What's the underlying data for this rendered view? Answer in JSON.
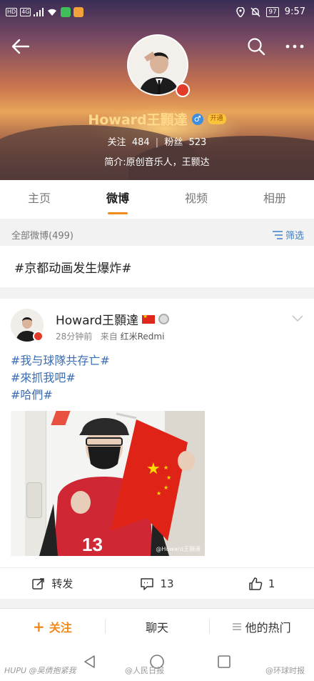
{
  "status_bar": {
    "left_chip1": "HD",
    "left_chip2": "4G",
    "battery": "97",
    "time": "9:57"
  },
  "profile": {
    "name": "Howard王顥達",
    "gender_symbol": "♂",
    "vip_label": "开通",
    "follow_label": "关注",
    "follow_count": "484",
    "fans_label": "粉丝",
    "fans_count": "523",
    "bio": "简介:原创音乐人，王颢达"
  },
  "tabs": [
    {
      "label": "主页"
    },
    {
      "label": "微博"
    },
    {
      "label": "视频"
    },
    {
      "label": "相册"
    }
  ],
  "filter_bar": {
    "all_posts": "全部微博(499)",
    "filter": "筛选"
  },
  "topic_card": {
    "text": "#京都动画发生爆炸#"
  },
  "post": {
    "author": "Howard王顥達",
    "time": "28分钟前",
    "from_label": "来自",
    "source": "红米Redmi",
    "tags": [
      "#我与球隊共存亡#",
      "#來抓我吧#",
      "#哈們#"
    ],
    "image_watermark": "@Howard王顥達",
    "repost_label": "转发",
    "comment_count": "13",
    "like_count": "1"
  },
  "bottom_bar": {
    "follow_plus": "+",
    "follow": "关注",
    "chat": "聊天",
    "hot": "他的热门"
  },
  "watermarks": {
    "left": "HUPU @吴倩抱紧我",
    "center": "@人民日报",
    "right": "@环球时报"
  },
  "colors": {
    "accent": "#f08a1c",
    "link": "#3a6db5",
    "name": "#ffd98a"
  }
}
